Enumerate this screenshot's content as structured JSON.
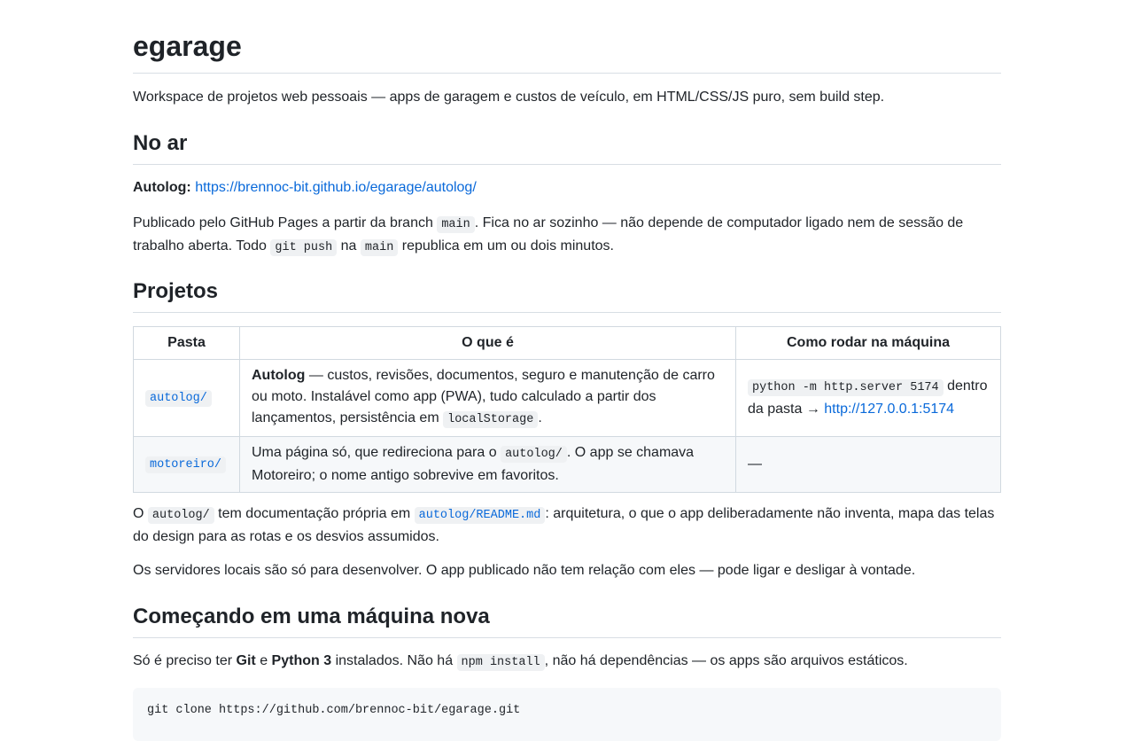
{
  "title": "egarage",
  "intro": "Workspace de projetos web pessoais — apps de garagem e custos de veículo, em HTML/CSS/JS puro, sem build step.",
  "no_ar": {
    "heading": "No ar",
    "autolog_label": "Autolog:",
    "autolog_link": "https://brennoc-bit.github.io/egarage/autolog/",
    "p1_a": "Publicado pelo GitHub Pages a partir da branch",
    "p1_code1": "main",
    "p1_b": ". Fica no ar sozinho — não depende de computador ligado nem de sessão de trabalho aberta. Todo",
    "p1_code2": "git push",
    "p1_c": "na",
    "p1_code3": "main",
    "p1_d": "republica em um ou dois minutos."
  },
  "projetos": {
    "heading": "Projetos",
    "headers": [
      "Pasta",
      "O que é",
      "Como rodar na máquina"
    ],
    "row1": {
      "folder": "autolog/",
      "name": "Autolog",
      "desc_a": "— custos, revisões, documentos, seguro e manutenção de carro ou moto. Instalável como app (PWA), tudo calculado a partir dos lançamentos, persistência em",
      "desc_code": "localStorage",
      "desc_b": ".",
      "run_code": "python -m http.server 5174",
      "run_a": "dentro da pasta →",
      "run_link": "http://127.0.0.1:5174"
    },
    "row2": {
      "folder": "motoreiro/",
      "desc_a": "Uma página só, que redireciona para o",
      "desc_code": "autolog/",
      "desc_b": ". O app se chamava Motoreiro; o nome antigo sobrevive em favoritos.",
      "run": "—"
    },
    "p_docs_a": "O",
    "p_docs_code1": "autolog/",
    "p_docs_b": "tem documentação própria em",
    "p_docs_code2": "autolog/README.md",
    "p_docs_c": ": arquitetura, o que o app deliberadamente não inventa, mapa das telas do design para as rotas e os desvios assumidos.",
    "p_servers": "Os servidores locais são só para desenvolver. O app publicado não tem relação com eles — pode ligar e desligar à vontade."
  },
  "comecando": {
    "heading": "Começando em uma máquina nova",
    "p_a": "Só é preciso ter",
    "git": "Git",
    "p_b": "e",
    "python": "Python 3",
    "p_c": "instalados. Não há",
    "npm": "npm install",
    "p_d": ", não há dependências — os apps são arquivos estáticos.",
    "code_line": "git clone https://github.com/brennoc-bit/egarage.git"
  }
}
